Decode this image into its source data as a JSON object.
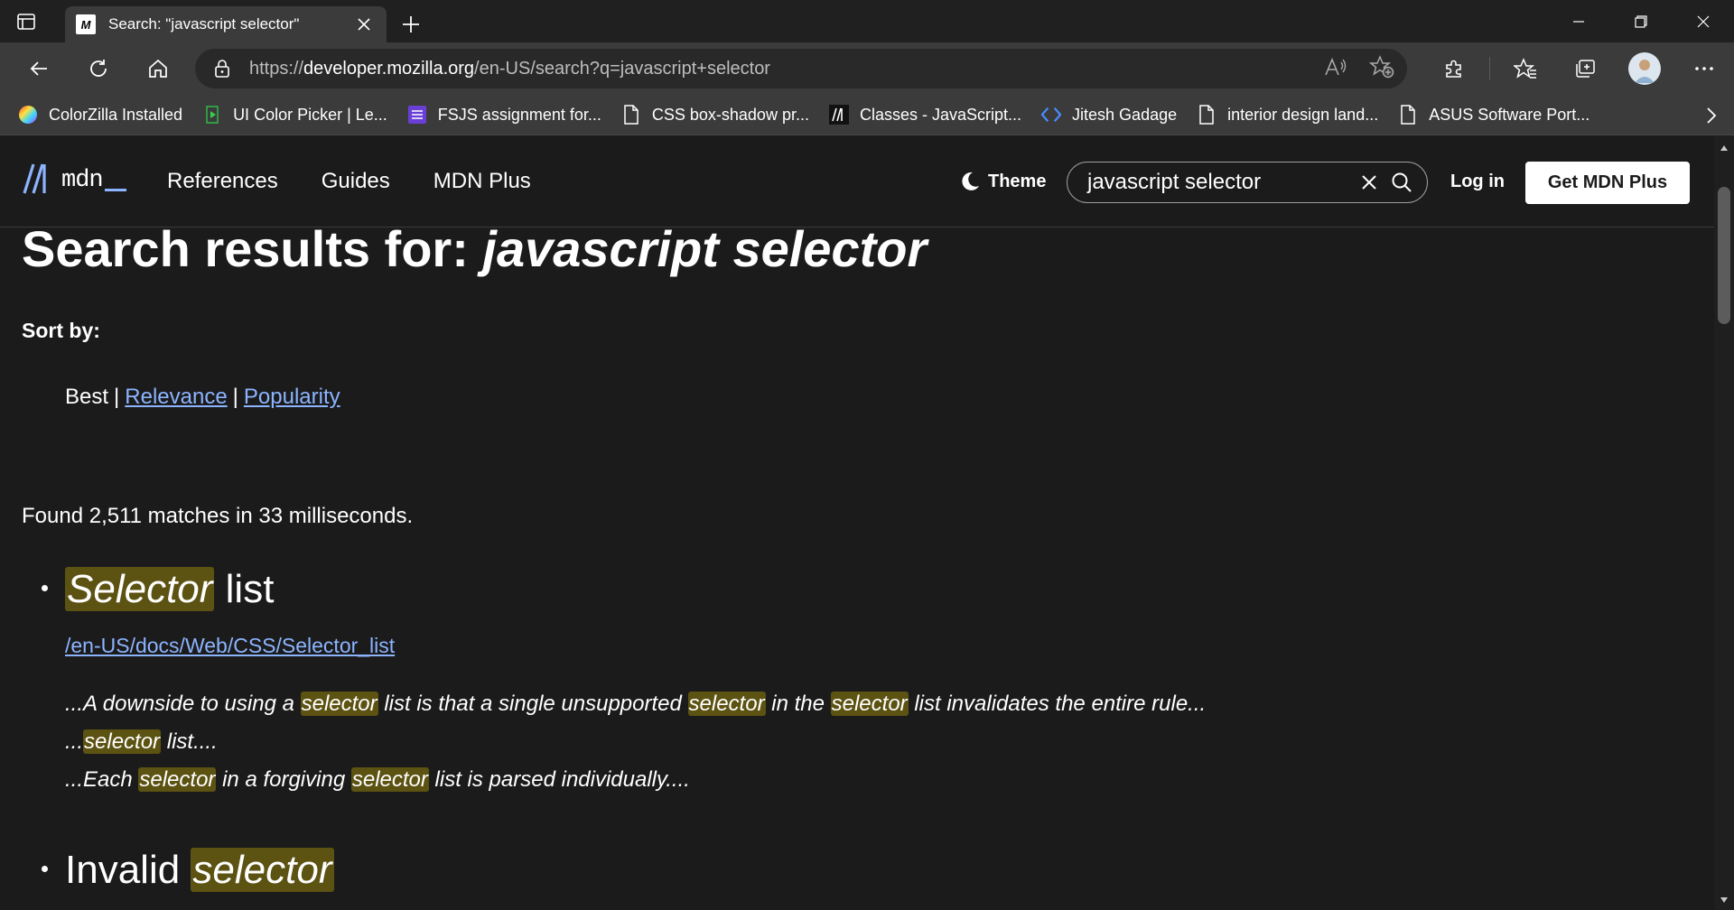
{
  "browser": {
    "tab": {
      "title": "Search: \"javascript selector\"",
      "favicon": "M"
    },
    "address": {
      "scheme": "https://",
      "host": "developer.mozilla.org",
      "path": "/en-US/search?q=javascript+selector"
    },
    "bookmarks": [
      {
        "label": "ColorZilla Installed",
        "icon": "colorzilla-icon"
      },
      {
        "label": "UI Color Picker | Le...",
        "icon": "play-icon"
      },
      {
        "label": "FSJS assignment for...",
        "icon": "list-icon"
      },
      {
        "label": "CSS box-shadow pr...",
        "icon": "page-icon"
      },
      {
        "label": "Classes - JavaScript...",
        "icon": "mdn-icon"
      },
      {
        "label": "Jitesh Gadage",
        "icon": "code-icon"
      },
      {
        "label": "interior design land...",
        "icon": "page-icon"
      },
      {
        "label": "ASUS Software Port...",
        "icon": "page-icon"
      }
    ]
  },
  "mdn": {
    "logo_text": "mdn",
    "nav": [
      "References",
      "Guides",
      "MDN Plus"
    ],
    "theme_label": "Theme",
    "search_value": "javascript selector",
    "login_label": "Log in",
    "get_plus_label": "Get MDN Plus"
  },
  "page": {
    "title_prefix": "Search results for: ",
    "title_query": "javascript selector",
    "sort_label": "Sort by:",
    "sort_current": "Best",
    "sort_links": [
      "Relevance",
      "Popularity"
    ],
    "found_text": "Found 2,511 matches in 33 milliseconds."
  },
  "results": [
    {
      "title_parts": [
        {
          "text": "Selector",
          "hl": true
        },
        {
          "text": " list",
          "hl": false
        }
      ],
      "url": "/en-US/docs/Web/CSS/Selector_list",
      "snippets": [
        [
          {
            "text": "...A downside to using a ",
            "hl": false
          },
          {
            "text": "selector",
            "hl": true
          },
          {
            "text": " list is that a single unsupported ",
            "hl": false
          },
          {
            "text": "selector",
            "hl": true
          },
          {
            "text": " in the ",
            "hl": false
          },
          {
            "text": "selector",
            "hl": true
          },
          {
            "text": " list invalidates the entire rule...",
            "hl": false
          }
        ],
        [
          {
            "text": "...",
            "hl": false
          },
          {
            "text": "selector",
            "hl": true
          },
          {
            "text": " list....",
            "hl": false
          }
        ],
        [
          {
            "text": "...Each ",
            "hl": false
          },
          {
            "text": "selector",
            "hl": true
          },
          {
            "text": " in a forgiving ",
            "hl": false
          },
          {
            "text": "selector",
            "hl": true
          },
          {
            "text": " list is parsed individually....",
            "hl": false
          }
        ]
      ]
    },
    {
      "title_parts": [
        {
          "text": "Invalid ",
          "hl": false
        },
        {
          "text": "selector",
          "hl": true
        }
      ],
      "url": "",
      "snippets": []
    }
  ]
}
